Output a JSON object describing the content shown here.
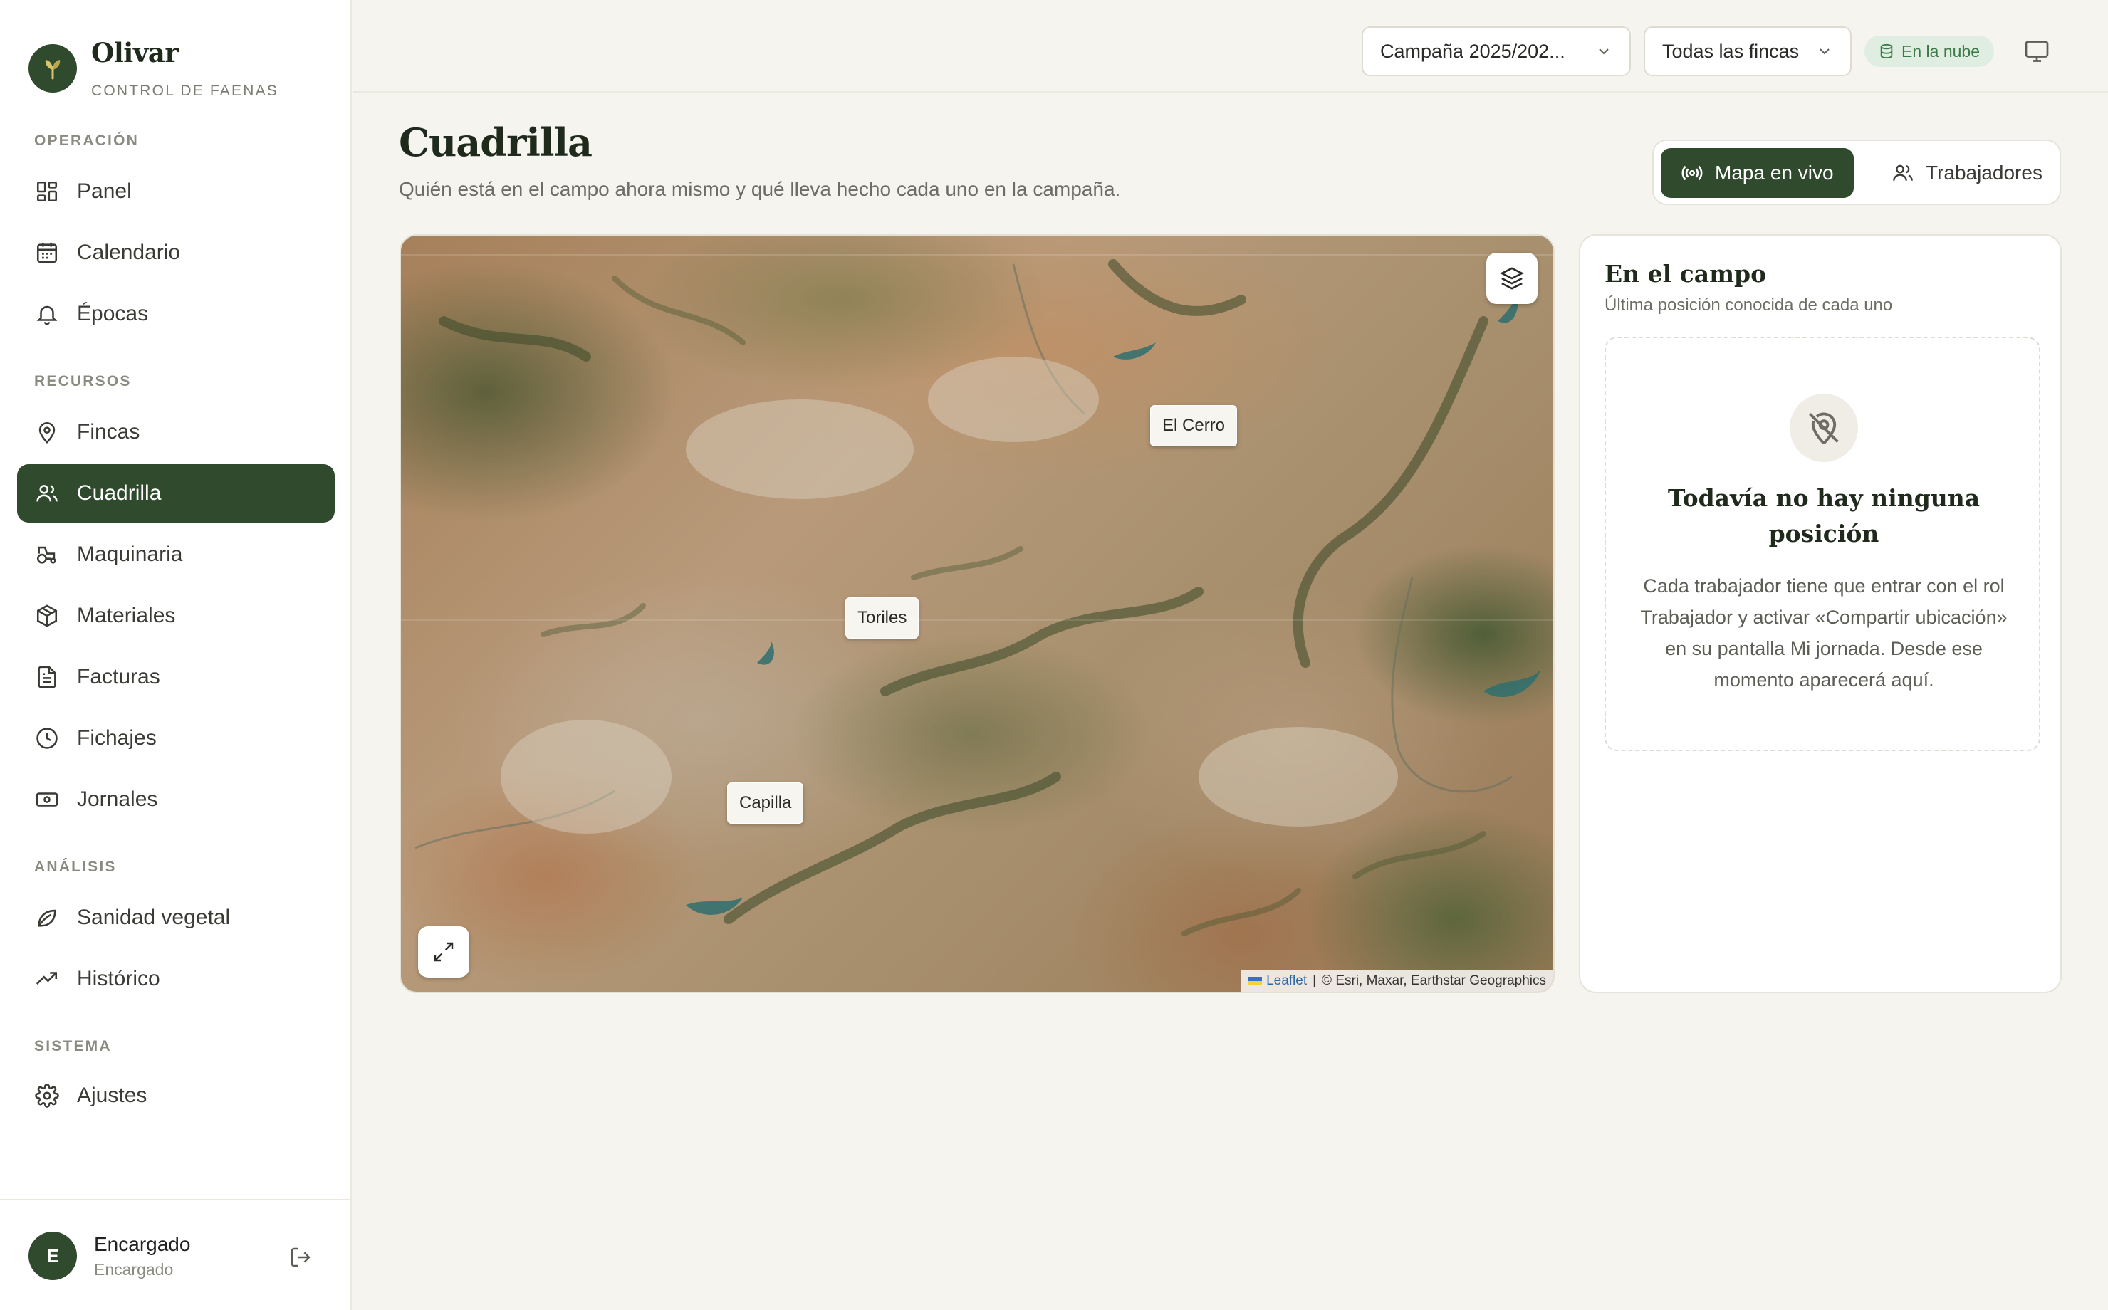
{
  "brand": {
    "name": "Olivar",
    "subtitle": "CONTROL DE FAENAS"
  },
  "sidebar": {
    "sections": {
      "operacion": "OPERACIÓN",
      "recursos": "RECURSOS",
      "analisis": "ANÁLISIS",
      "sistema": "SISTEMA"
    },
    "items": {
      "panel": "Panel",
      "calendario": "Calendario",
      "epocas": "Épocas",
      "fincas": "Fincas",
      "cuadrilla": "Cuadrilla",
      "maquinaria": "Maquinaria",
      "materiales": "Materiales",
      "facturas": "Facturas",
      "fichajes": "Fichajes",
      "jornales": "Jornales",
      "sanidad": "Sanidad vegetal",
      "historico": "Histórico",
      "ajustes": "Ajustes"
    },
    "active": "Cuadrilla"
  },
  "user": {
    "initial": "E",
    "name": "Encargado",
    "role": "Encargado"
  },
  "topbar": {
    "campaign_select": "Campaña 2025/202...",
    "farm_select": "Todas las fincas",
    "cloud_badge": "En la nube"
  },
  "page": {
    "title": "Cuadrilla",
    "subtitle": "Quién está en el campo ahora mismo y qué lleva hecho cada uno en la campaña."
  },
  "view_toggle": {
    "live_map": "Mapa en vivo",
    "workers": "Trabajadores",
    "active": "Mapa en vivo"
  },
  "map": {
    "labels": {
      "el_cerro": "El Cerro",
      "toriles": "Toriles",
      "capilla": "Capilla"
    },
    "attribution_leaflet": "Leaflet",
    "attribution_sep": "|",
    "attribution_source": "© Esri, Maxar, Earthstar Geographics"
  },
  "field_panel": {
    "title": "En el campo",
    "subtitle": "Última posición conocida de cada uno",
    "empty_title": "Todavía no hay ninguna posición",
    "empty_text": "Cada trabajador tiene que entrar con el rol Trabajador y activar «Compartir ubicación» en su pantalla Mi jornada. Desde ese momento aparecerá aquí."
  },
  "colors": {
    "accent": "#2f4a2c",
    "background": "#f6f4ee",
    "cloud_badge_bg": "#dfeee0",
    "cloud_badge_text": "#3b7a48"
  }
}
